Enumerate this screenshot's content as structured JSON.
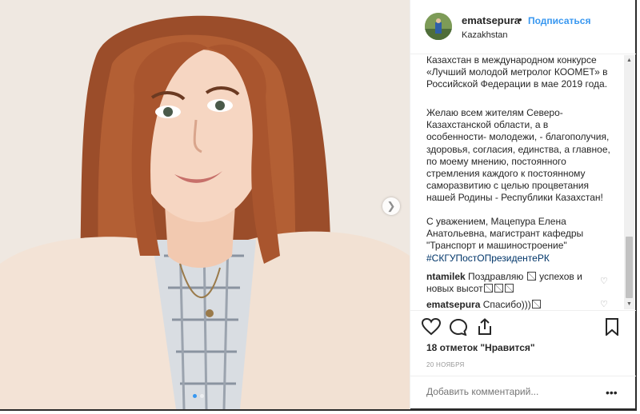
{
  "post": {
    "username": "ematsepura",
    "separator": "•",
    "follow_label": "Подписаться",
    "location": "Kazakhstan"
  },
  "caption": {
    "p1_l1": "Казахстан в международном конкурсе",
    "p1_l2": "«Лучший молодой метролог КООМЕТ» в",
    "p1_l3": "Российской Федерации в мае 2019 года.",
    "p2_l1": "Желаю всем жителям Северо-",
    "p2_l2": "Казахстанской области, а в",
    "p2_l3": "особенности- молодежи, - благополучия,",
    "p2_l4": "здоровья, согласия, единства, а главное,",
    "p2_l5": "по моему мнению, постоянного",
    "p2_l6": "стремления каждого к постоянному",
    "p2_l7": "саморазвитию с целью процветания",
    "p2_l8": "нашей Родины - Республики Казахстан!",
    "p3_l1": "С уважением, Мацепура Елена",
    "p3_l2": "Анатольевна, магистрант кафедры",
    "p3_l3": "\"Транспорт и машиностроение\"",
    "hashtag": "#СКГУПостОПрезидентеРК"
  },
  "comments": [
    {
      "user": "ntamilek",
      "text_a": "Поздравляю",
      "text_b": "успехов и",
      "text_c": "новых высот"
    },
    {
      "user": "ematsepura",
      "text_a": "Спасибо)))"
    }
  ],
  "likes_text": "18 отметок \"Нравится\"",
  "date": "20 НОЯБРЯ",
  "add_comment_placeholder": "Добавить комментарий...",
  "more_label": "•••",
  "icons": {
    "heart": "heart-icon",
    "comment": "comment-icon",
    "share": "share-icon",
    "bookmark": "bookmark-icon",
    "next": "chevron-right-icon"
  },
  "colors": {
    "link": "#3897f0",
    "hashtag": "#003569",
    "text": "#262626",
    "muted": "#999999"
  },
  "carousel": {
    "total_slides": 2,
    "active_slide": 1
  }
}
